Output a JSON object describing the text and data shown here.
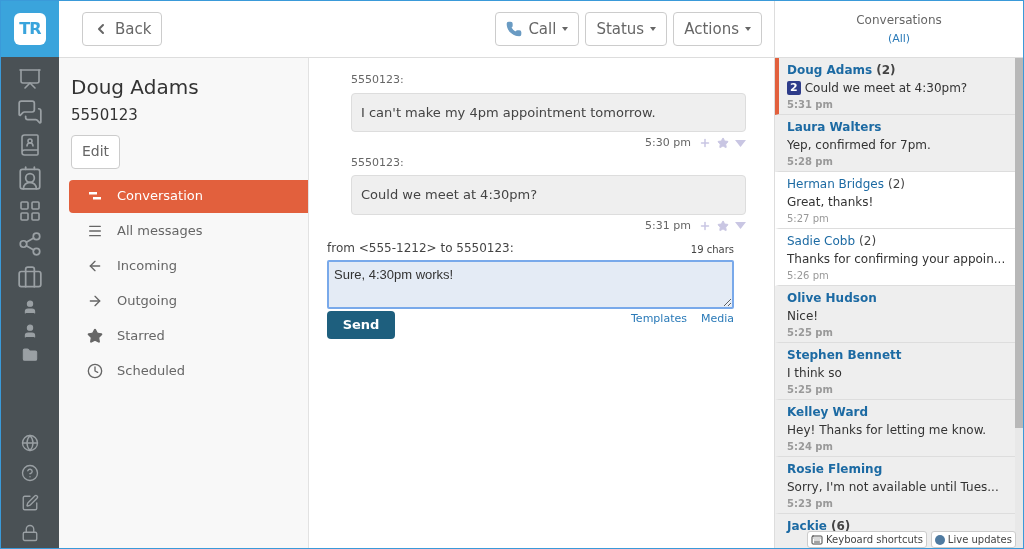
{
  "app": {
    "logo": "TR"
  },
  "toolbar": {
    "back": "Back",
    "buttons": [
      {
        "label": "Call"
      },
      {
        "label": "Status"
      },
      {
        "label": "Actions"
      }
    ]
  },
  "contact": {
    "name": "Doug Adams",
    "number": "5550123",
    "edit": "Edit"
  },
  "nav": [
    {
      "label": "Conversation",
      "selected": true
    },
    {
      "label": "All messages",
      "selected": false
    },
    {
      "label": "Incoming",
      "selected": false
    },
    {
      "label": "Outgoing",
      "selected": false
    },
    {
      "label": "Starred",
      "selected": false
    },
    {
      "label": "Scheduled",
      "selected": false
    }
  ],
  "messages": [
    {
      "sender": "5550123:",
      "text": "I can't make my 4pm appointment tomorrow.",
      "time": "5:30 pm"
    },
    {
      "sender": "5550123:",
      "text": "Could we meet at 4:30pm?",
      "time": "5:31 pm"
    }
  ],
  "compose": {
    "header": "from <555-1212> to 5550123:",
    "count": "19 chars",
    "value": "Sure, 4:30pm works!",
    "links": [
      "Templates",
      "Media"
    ],
    "send": "Send"
  },
  "conversations": {
    "title": "Conversations",
    "filter": "(All)",
    "items": [
      {
        "name": "Doug Adams",
        "count": "(2)",
        "badge": "2",
        "preview": "Could we meet at 4:30pm?",
        "time": "5:31 pm",
        "unread": true,
        "selected": true
      },
      {
        "name": "Laura Walters",
        "preview": "Yep, confirmed for 7pm.",
        "time": "5:28 pm",
        "unread": true,
        "selected": false
      },
      {
        "name": "Herman Bridges",
        "count": "(2)",
        "preview": "Great, thanks!",
        "time": "5:27 pm",
        "unread": false,
        "selected": false
      },
      {
        "name": "Sadie Cobb",
        "count": "(2)",
        "preview": "Thanks for confirming your appoin...",
        "time": "5:26 pm",
        "unread": false,
        "selected": false
      },
      {
        "name": "Olive Hudson",
        "preview": "Nice!",
        "time": "5:25 pm",
        "unread": true,
        "selected": false
      },
      {
        "name": "Stephen Bennett",
        "preview": "I think so",
        "time": "5:25 pm",
        "unread": true,
        "selected": false
      },
      {
        "name": "Kelley Ward",
        "preview": "Hey! Thanks for letting me know.",
        "time": "5:24 pm",
        "unread": true,
        "selected": false
      },
      {
        "name": "Rosie Fleming",
        "preview": "Sorry, I'm not available until Tues...",
        "time": "5:23 pm",
        "unread": true,
        "selected": false
      },
      {
        "name": "Jackie",
        "count": "(6)",
        "unread": true,
        "selected": false
      }
    ]
  },
  "footer": [
    "Keyboard shortcuts",
    "Live updates"
  ]
}
